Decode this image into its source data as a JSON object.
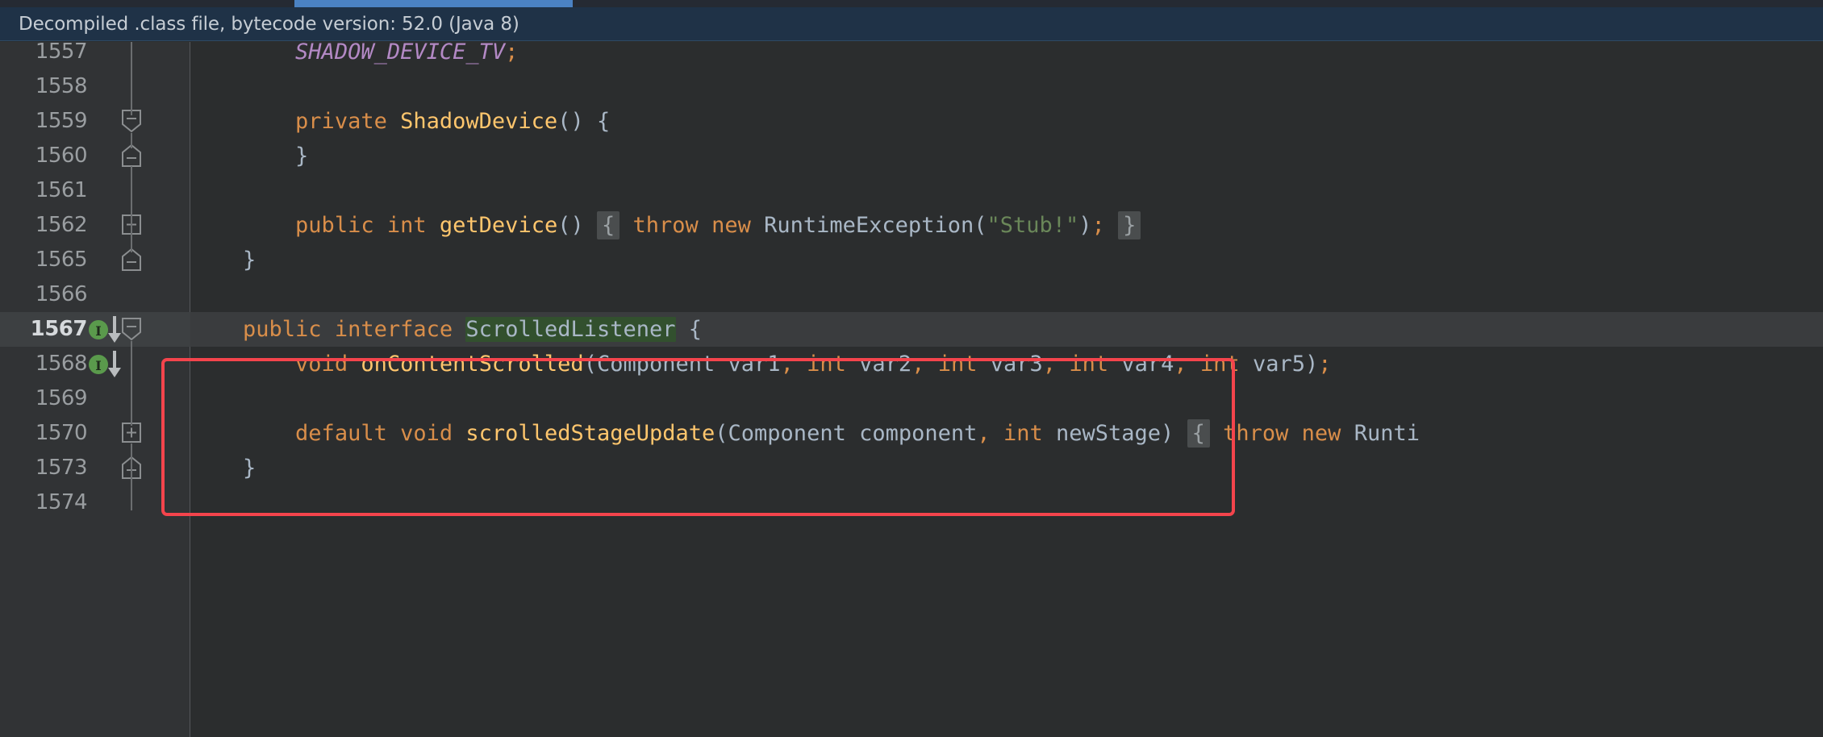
{
  "window": {
    "tab_underline_color": "#4b82c3",
    "banner_bg": "#1f3247",
    "editor_bg": "#2b2d2e",
    "gutter_bg": "#313335",
    "annotation_color": "#f4444c"
  },
  "banner": {
    "text": "Decompiled .class file, bytecode version: 52.0 (Java 8)"
  },
  "editor": {
    "current_line": "1567",
    "lines": [
      {
        "number": "1557",
        "fold": "none",
        "impl": "none",
        "tokens": [
          {
            "t": "        ",
            "c": "plain"
          },
          {
            "t": "SHADOW_DEVICE_TV",
            "c": "const"
          },
          {
            "t": ";",
            "c": "kw"
          }
        ]
      },
      {
        "number": "1558",
        "fold": "none",
        "impl": "none",
        "tokens": []
      },
      {
        "number": "1559",
        "fold": "collapse-down",
        "impl": "none",
        "tokens": [
          {
            "t": "        ",
            "c": "plain"
          },
          {
            "t": "private",
            "c": "kw"
          },
          {
            "t": " ",
            "c": "plain"
          },
          {
            "t": "ShadowDevice",
            "c": "mth"
          },
          {
            "t": "(",
            "c": "punc"
          },
          {
            "t": ")",
            "c": "punc"
          },
          {
            "t": " ",
            "c": "plain"
          },
          {
            "t": "{",
            "c": "brace"
          }
        ]
      },
      {
        "number": "1560",
        "fold": "collapse-up",
        "impl": "none",
        "tokens": [
          {
            "t": "        ",
            "c": "plain"
          },
          {
            "t": "}",
            "c": "brace"
          }
        ]
      },
      {
        "number": "1561",
        "fold": "none",
        "impl": "none",
        "tokens": []
      },
      {
        "number": "1562",
        "fold": "expand",
        "impl": "none",
        "tokens": [
          {
            "t": "        ",
            "c": "plain"
          },
          {
            "t": "public",
            "c": "kw"
          },
          {
            "t": " ",
            "c": "plain"
          },
          {
            "t": "int",
            "c": "kw"
          },
          {
            "t": " ",
            "c": "plain"
          },
          {
            "t": "getDevice",
            "c": "mth"
          },
          {
            "t": "()",
            "c": "punc"
          },
          {
            "t": " ",
            "c": "plain"
          },
          {
            "t": "{",
            "c": "hl-brace"
          },
          {
            "t": " ",
            "c": "plain"
          },
          {
            "t": "throw",
            "c": "kw"
          },
          {
            "t": " ",
            "c": "plain"
          },
          {
            "t": "new",
            "c": "kw"
          },
          {
            "t": " ",
            "c": "plain"
          },
          {
            "t": "RuntimeException",
            "c": "cls"
          },
          {
            "t": "(",
            "c": "punc"
          },
          {
            "t": "\"Stub!\"",
            "c": "str"
          },
          {
            "t": ")",
            "c": "punc"
          },
          {
            "t": ";",
            "c": "kw"
          },
          {
            "t": " ",
            "c": "plain"
          },
          {
            "t": "}",
            "c": "hl-brace"
          }
        ]
      },
      {
        "number": "1565",
        "fold": "collapse-up",
        "impl": "none",
        "tokens": [
          {
            "t": "    ",
            "c": "plain"
          },
          {
            "t": "}",
            "c": "brace"
          }
        ]
      },
      {
        "number": "1566",
        "fold": "none",
        "impl": "none",
        "tokens": []
      },
      {
        "number": "1567",
        "fold": "collapse-down",
        "impl": "implemented-down",
        "tokens": [
          {
            "t": "    ",
            "c": "plain"
          },
          {
            "t": "public",
            "c": "kw"
          },
          {
            "t": " ",
            "c": "plain"
          },
          {
            "t": "interface",
            "c": "kw"
          },
          {
            "t": " ",
            "c": "plain"
          },
          {
            "t": "ScrolledListener",
            "c": "hl-search"
          },
          {
            "t": " ",
            "c": "plain"
          },
          {
            "t": "{",
            "c": "brace"
          }
        ]
      },
      {
        "number": "1568",
        "fold": "none",
        "impl": "implemented-down",
        "tokens": [
          {
            "t": "        ",
            "c": "plain"
          },
          {
            "t": "void",
            "c": "kw"
          },
          {
            "t": " ",
            "c": "plain"
          },
          {
            "t": "onContentScrolled",
            "c": "mth"
          },
          {
            "t": "(",
            "c": "punc"
          },
          {
            "t": "Component",
            "c": "cls"
          },
          {
            "t": " ",
            "c": "plain"
          },
          {
            "t": "var1",
            "c": "param"
          },
          {
            "t": ",",
            "c": "kw"
          },
          {
            "t": " ",
            "c": "plain"
          },
          {
            "t": "int",
            "c": "kw"
          },
          {
            "t": " ",
            "c": "plain"
          },
          {
            "t": "var2",
            "c": "param"
          },
          {
            "t": ",",
            "c": "kw"
          },
          {
            "t": " ",
            "c": "plain"
          },
          {
            "t": "int",
            "c": "kw"
          },
          {
            "t": " ",
            "c": "plain"
          },
          {
            "t": "var3",
            "c": "param"
          },
          {
            "t": ",",
            "c": "kw"
          },
          {
            "t": " ",
            "c": "plain"
          },
          {
            "t": "int",
            "c": "kw"
          },
          {
            "t": " ",
            "c": "plain"
          },
          {
            "t": "var4",
            "c": "param"
          },
          {
            "t": ",",
            "c": "kw"
          },
          {
            "t": " ",
            "c": "plain"
          },
          {
            "t": "int",
            "c": "kw"
          },
          {
            "t": " ",
            "c": "plain"
          },
          {
            "t": "var5",
            "c": "param"
          },
          {
            "t": ")",
            "c": "punc"
          },
          {
            "t": ";",
            "c": "kw"
          }
        ]
      },
      {
        "number": "1569",
        "fold": "none",
        "impl": "none",
        "tokens": []
      },
      {
        "number": "1570",
        "fold": "expand",
        "impl": "none",
        "tokens": [
          {
            "t": "        ",
            "c": "plain"
          },
          {
            "t": "default",
            "c": "kw"
          },
          {
            "t": " ",
            "c": "plain"
          },
          {
            "t": "void",
            "c": "kw"
          },
          {
            "t": " ",
            "c": "plain"
          },
          {
            "t": "scrolledStageUpdate",
            "c": "mth"
          },
          {
            "t": "(",
            "c": "punc"
          },
          {
            "t": "Component",
            "c": "cls"
          },
          {
            "t": " ",
            "c": "plain"
          },
          {
            "t": "component",
            "c": "param"
          },
          {
            "t": ",",
            "c": "kw"
          },
          {
            "t": " ",
            "c": "plain"
          },
          {
            "t": "int",
            "c": "kw"
          },
          {
            "t": " ",
            "c": "plain"
          },
          {
            "t": "newStage",
            "c": "param"
          },
          {
            "t": ")",
            "c": "punc"
          },
          {
            "t": " ",
            "c": "plain"
          },
          {
            "t": "{",
            "c": "hl-brace"
          },
          {
            "t": " ",
            "c": "plain"
          },
          {
            "t": "throw",
            "c": "kw"
          },
          {
            "t": " ",
            "c": "plain"
          },
          {
            "t": "new",
            "c": "kw"
          },
          {
            "t": " ",
            "c": "plain"
          },
          {
            "t": "Runti",
            "c": "cls"
          }
        ]
      },
      {
        "number": "1573",
        "fold": "collapse-up",
        "impl": "none",
        "tokens": [
          {
            "t": "    ",
            "c": "plain"
          },
          {
            "t": "}",
            "c": "brace"
          }
        ]
      },
      {
        "number": "1574",
        "fold": "none",
        "impl": "none",
        "tokens": []
      }
    ]
  }
}
